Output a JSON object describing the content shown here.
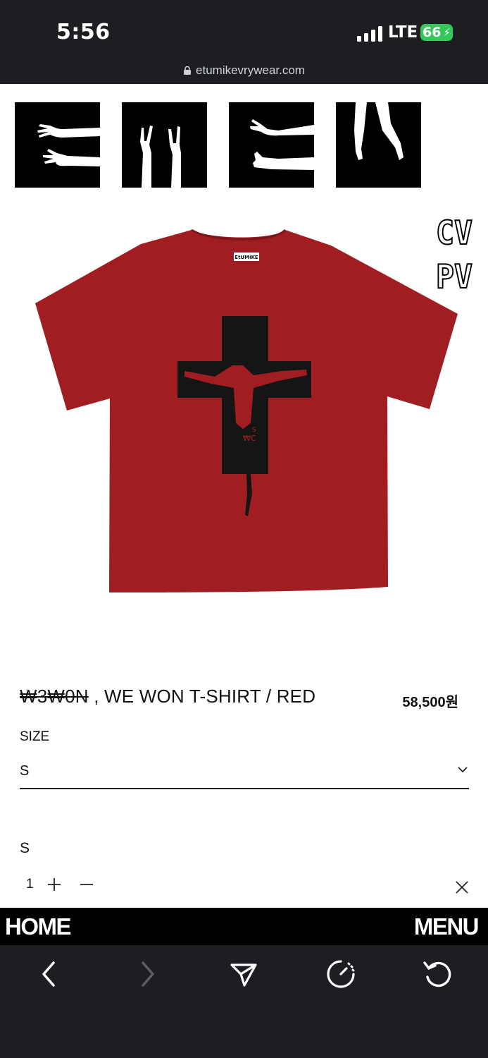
{
  "status_bar": {
    "time": "5:56",
    "network": "LTE",
    "battery": "66"
  },
  "browser": {
    "url": "etumikevrywear.com"
  },
  "brand": {
    "logo_text": "CV PV"
  },
  "product": {
    "title_strike": "₩3₩0N",
    "title_rest": " , WE WON T-SHIRT / RED",
    "price": "58,500원",
    "image_tag_text": "EtUMiKE"
  },
  "options": {
    "size_label": "SIZE",
    "size_selected": "S"
  },
  "selected_item": {
    "size": "S",
    "quantity": "1"
  },
  "site_nav": {
    "home_label": "HOME",
    "menu_label": "MENU"
  },
  "colors": {
    "shirt": "#a01e22",
    "accent_battery": "#34c759",
    "chrome": "#1c1e21"
  }
}
